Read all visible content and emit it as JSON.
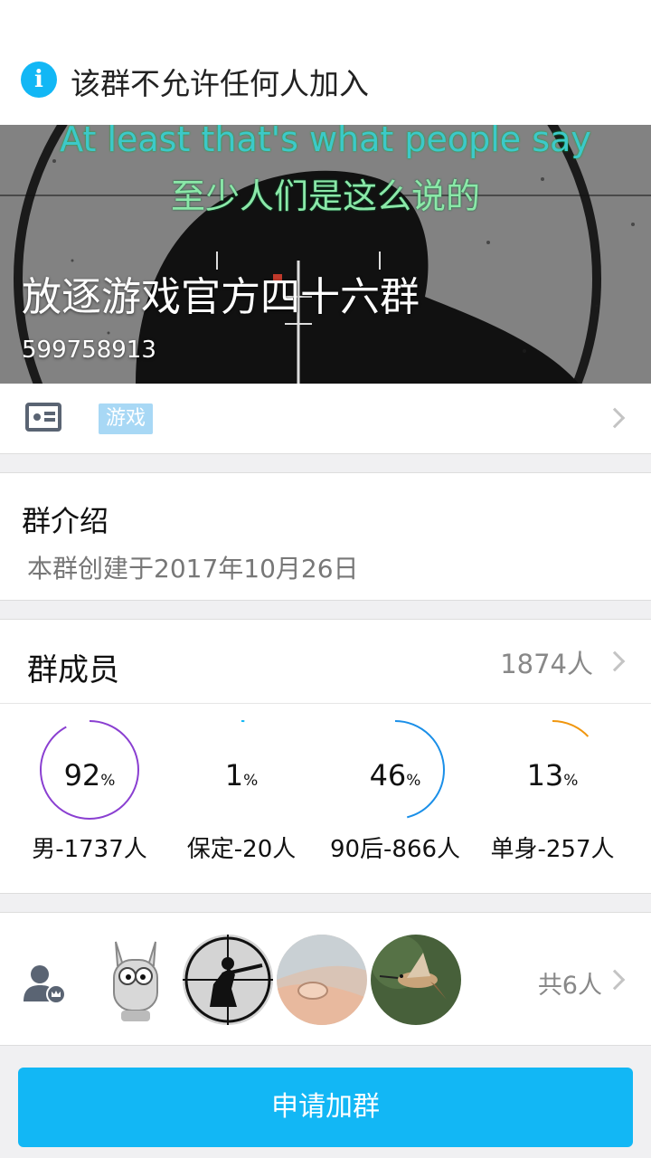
{
  "notice": {
    "text": "该群不允许任何人加入",
    "icon": "info-icon"
  },
  "banner": {
    "lyric_en": "At least that's what people say",
    "lyric_zh": "至少人们是这么说的",
    "group_name": "放逐游戏官方四十六群",
    "group_id": "599758913"
  },
  "tag_row": {
    "icon": "id-card-icon",
    "tag": "游戏"
  },
  "intro": {
    "title": "群介绍",
    "description": "本群创建于2017年10月26日"
  },
  "members": {
    "title": "群成员",
    "count": "1874人",
    "stats": [
      {
        "value": "92",
        "unit": "%",
        "label": "男-1737人",
        "color": "#8a3fd1",
        "percent": 92
      },
      {
        "value": "1",
        "unit": "%",
        "label": "保定-20人",
        "color": "#12b7f5",
        "percent": 1
      },
      {
        "value": "46",
        "unit": "%",
        "label": "90后-866人",
        "color": "#1a8fe8",
        "percent": 46
      },
      {
        "value": "13",
        "unit": "%",
        "label": "单身-257人",
        "color": "#f0960e",
        "percent": 13
      }
    ]
  },
  "admins": {
    "icon": "admin-user-icon",
    "total": "共6人"
  },
  "action": {
    "join_label": "申请加群",
    "color": "#12b7f5"
  }
}
